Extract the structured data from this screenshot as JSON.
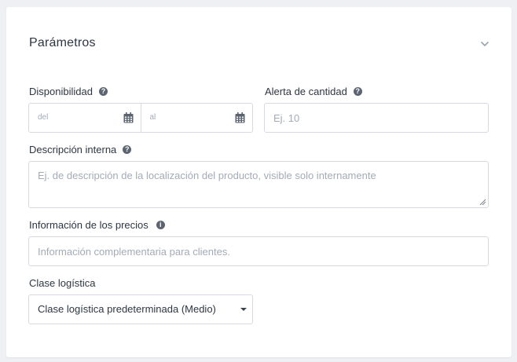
{
  "section": {
    "title": "Parámetros",
    "collapse_icon": "chevron-down-icon"
  },
  "availability": {
    "label": "Disponibilidad",
    "from_placeholder": "del",
    "to_placeholder": "al",
    "help_icon": "question-circle-icon",
    "calendar_icon": "calendar-icon"
  },
  "quantity_alert": {
    "label": "Alerta de cantidad",
    "placeholder": "Ej. 10",
    "help_icon": "question-circle-icon"
  },
  "internal_description": {
    "label": "Descripción interna",
    "placeholder": "Ej. de descripción de la localización del producto, visible solo internamente",
    "help_icon": "question-circle-icon"
  },
  "price_info": {
    "label": "Información de los precios",
    "placeholder": "Información complementaria para clientes.",
    "info_icon": "info-circle-icon"
  },
  "logistics_class": {
    "label": "Clase logística",
    "selected": "Clase logística predeterminada (Medio)",
    "caret_icon": "caret-down-icon"
  },
  "colors": {
    "page_background": "#eef0f3",
    "card_background": "#ffffff",
    "border": "#d6dae0",
    "placeholder_text": "#a3abb5",
    "label_text": "#2d3640",
    "icon": "#5b6470"
  }
}
